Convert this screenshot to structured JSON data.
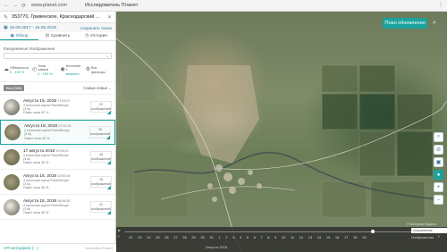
{
  "browser": {
    "nav_back": "←",
    "nav_forward": "→",
    "nav_reload": "⟳",
    "url": "www.planet.com",
    "tab_title": "Исследователь Планет",
    "menu": "⋮"
  },
  "location": {
    "title": "353770, Гривенское, Краснодарский ...",
    "pin_icon": "✎",
    "close_icon": "✕"
  },
  "date_range": {
    "cal_icon": "▣",
    "range": "15.08.2017 - 15.08.2018",
    "save_label": "сохранить поиск"
  },
  "tabs": [
    {
      "label": "Обзор",
      "icon": "◉"
    },
    {
      "label": "Сравнить",
      "icon": "⊟"
    },
    {
      "label": "История",
      "icon": "◷"
    }
  ],
  "imagery": {
    "section_label": "Ежедневные Изображения",
    "select_value": "",
    "filters": [
      {
        "icon": "☁",
        "label": "Облачность",
        "value": "0 - 100 %"
      },
      {
        "icon": "◴",
        "label": "Зона охвата",
        "value": "0 - 100 %"
      },
      {
        "icon": "◉",
        "label": "Источник",
        "value": "1 включен"
      },
      {
        "icon": "⚙",
        "label": "Все фильтры",
        "value": ""
      }
    ]
  },
  "list": {
    "all_label": "Все (356)",
    "sort_label": "Самые новые",
    "sort_chev": "⌄",
    "items": [
      {
        "date": "Августа 19, 2018",
        "time": "17:09:01",
        "line1": "4 полосная сцена PlanetScope",
        "line2": "(3 м)",
        "cloud": "Охват зоны 92 %",
        "count": "22",
        "count_label": "изображений"
      },
      {
        "date": "Августа 18, 2018",
        "time": "07:02:16",
        "line1": "4 полосная сцена PlanetScope",
        "line2": "(3 м)",
        "cloud": "Охват зоны 36 %",
        "count": "26",
        "count_label": "изображений"
      },
      {
        "date": "17 августа 2018",
        "time": "10:06:20",
        "line1": "4 полосная сцена PlanetScope",
        "line2": "(3 м)",
        "cloud": "Охват зоны 36 %",
        "count": "45",
        "count_label": "изображений"
      },
      {
        "date": "Августа 16, 2018",
        "time": "10:00:09",
        "line1": "4 полосная сцена PlanetScope",
        "line2": "(3 м)",
        "cloud": "Охват зоны 36 %",
        "count": "18",
        "count_label": "изображений"
      },
      {
        "date": "Августа 15, 2018",
        "time": "08:58:30",
        "line1": "4 полосная сцена PlanetScope",
        "line2": "(3 м)",
        "cloud": "Охват зоны 36 %",
        "count": "31",
        "count_label": "изображений"
      }
    ]
  },
  "api": {
    "label": "API-интерфейс {···}",
    "extra": "Настройки Планет"
  },
  "map": {
    "plan_button": "План обновления",
    "search_icon": "⌕",
    "tools": [
      "⌕",
      "⊘",
      "▣",
      "●",
      "+",
      "−"
    ],
    "timeline": {
      "month": "Августа 2018",
      "ticks": [
        "22",
        "23",
        "24",
        "25",
        "26",
        "27",
        "28",
        "29",
        "30",
        "31",
        "1",
        "2",
        "3",
        "4",
        "5",
        "6",
        "7",
        "8",
        "9",
        "10",
        "11",
        "12",
        "13",
        "14",
        "15",
        "16",
        "17",
        "18",
        "19"
      ],
      "right_label": "сохранение",
      "right2": "Изображения",
      "play": "▶",
      "arrow_left": "‹",
      "arrow_right": "›"
    },
    "copyright": "© Материал Mapbox"
  }
}
